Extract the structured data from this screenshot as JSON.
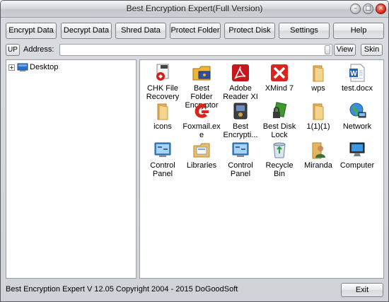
{
  "window": {
    "title": "Best Encryption Expert(Full Version)",
    "minimize_glyph": "–",
    "maximize_glyph": "□",
    "close_glyph": "×"
  },
  "toolbar": {
    "buttons": [
      "Encrypt Data",
      "Decrypt Data",
      "Shred Data",
      "Protect Folder",
      "Protect Disk",
      "Settings",
      "Help"
    ]
  },
  "address_bar": {
    "up_label": "UP",
    "label": "Address:",
    "value": "",
    "view_label": "View",
    "skin_label": "Skin"
  },
  "tree": {
    "expander": "+",
    "root_label": "Desktop",
    "root_icon": "desktop-icon"
  },
  "files": [
    {
      "label": "CHK File Recovery",
      "icon": "chk-recovery-icon"
    },
    {
      "label": "Best Folder Encryptor",
      "icon": "folder-encryptor-icon"
    },
    {
      "label": "Adobe Reader XI",
      "icon": "adobe-reader-icon"
    },
    {
      "label": "XMind 7",
      "icon": "xmind-icon"
    },
    {
      "label": "wps",
      "icon": "folder-icon"
    },
    {
      "label": "test.docx",
      "icon": "word-document-icon"
    },
    {
      "label": "icons",
      "icon": "folder-icon"
    },
    {
      "label": "Foxmail.exe",
      "icon": "foxmail-icon"
    },
    {
      "label": "Best Encrypti...",
      "icon": "encryption-expert-icon"
    },
    {
      "label": "Best Disk Lock",
      "icon": "disk-lock-icon"
    },
    {
      "label": "1(1)(1)",
      "icon": "folder-icon"
    },
    {
      "label": "Network",
      "icon": "network-icon"
    },
    {
      "label": "Control Panel",
      "icon": "control-panel-icon"
    },
    {
      "label": "Libraries",
      "icon": "libraries-icon"
    },
    {
      "label": "Control Panel",
      "icon": "control-panel-icon"
    },
    {
      "label": "Recycle Bin",
      "icon": "recycle-bin-icon"
    },
    {
      "label": "Miranda",
      "icon": "user-folder-icon"
    },
    {
      "label": "Computer",
      "icon": "computer-icon"
    }
  ],
  "status": {
    "text": "Best Encryption Expert  V 12.05  Copyright 2004 - 2015 DoGoodSoft",
    "exit_label": "Exit"
  }
}
